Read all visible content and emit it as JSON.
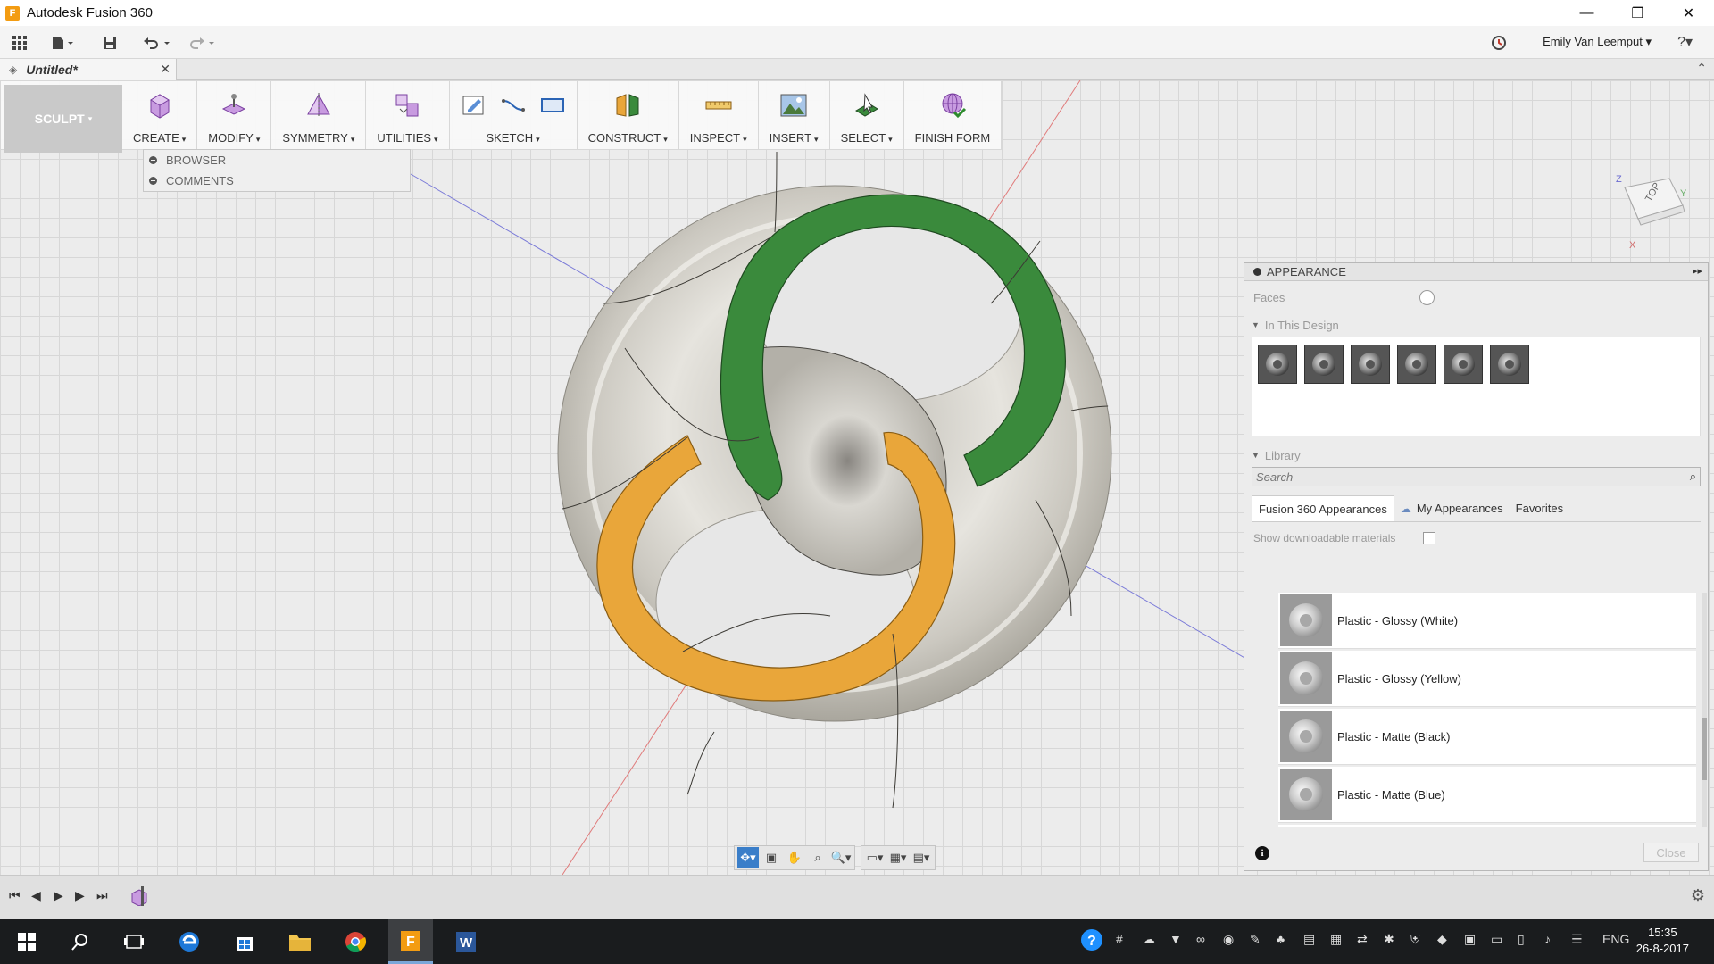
{
  "window": {
    "title": "Autodesk Fusion 360",
    "app_icon": "F",
    "minimize_glyph": "—",
    "restore_glyph": "❐",
    "close_glyph": "✕"
  },
  "quick_access": {
    "user_name": "Emily Van Leemput",
    "user_caret": "▾",
    "help_glyph": "?▾"
  },
  "document_tab": {
    "label": "Untitled*",
    "close_glyph": "✕",
    "collapse_glyph": "⌃"
  },
  "ribbon": {
    "workspace_label": "SCULPT",
    "workspace_caret": "▾",
    "groups": [
      {
        "label": "CREATE",
        "icon": "create-box-icon"
      },
      {
        "label": "MODIFY",
        "icon": "modify-icon"
      },
      {
        "label": "SYMMETRY",
        "icon": "symmetry-icon"
      },
      {
        "label": "UTILITIES",
        "icon": "utilities-icon"
      },
      {
        "label": "SKETCH",
        "icon": "sketch-icon"
      },
      {
        "label": "CONSTRUCT",
        "icon": "construct-plane-icon"
      },
      {
        "label": "INSPECT",
        "icon": "measure-icon"
      },
      {
        "label": "INSERT",
        "icon": "insert-image-icon"
      },
      {
        "label": "SELECT",
        "icon": "select-icon"
      },
      {
        "label": "FINISH FORM",
        "icon": "finish-form-icon"
      }
    ],
    "caret": "▾"
  },
  "browser": {
    "items": [
      "BROWSER",
      "COMMENTS"
    ]
  },
  "viewcube": {
    "face": "TOP",
    "axis_z": "Z",
    "axis_x": "X",
    "axis_y": "Y"
  },
  "appearance": {
    "title": "APPEARANCE",
    "pin_glyph": "▸▸",
    "faces_label": "Faces",
    "in_this_design_label": "In This Design",
    "design_swatch_count": 6,
    "library_label": "Library",
    "search_placeholder": "Search",
    "tabs": [
      "Fusion 360 Appearances",
      "My Appearances",
      "Favorites"
    ],
    "show_downloadable_label": "Show downloadable materials",
    "materials": [
      "Plastic - Glossy (White)",
      "Plastic - Glossy (Yellow)",
      "Plastic - Matte (Black)",
      "Plastic - Matte (Blue)"
    ],
    "info_glyph": "i",
    "close_label": "Close"
  },
  "navbar": {
    "buttons": [
      "✥▾",
      "▣",
      "✋",
      "⌕",
      "🔍▾",
      "▭▾",
      "▦▾",
      "▤▾"
    ]
  },
  "timeline": {
    "buttons": [
      "⏮",
      "◀",
      "▶",
      "▶",
      "⏭"
    ],
    "gear_glyph": "⚙"
  },
  "taskbar": {
    "language": "ENG",
    "time": "15:35",
    "date": "26-8-2017"
  },
  "colors": {
    "green_ring": "#3a8a3c",
    "yellow_ring": "#e9a63a",
    "model_body": "#d8d6cf",
    "accent_blue": "#3a7ec9"
  }
}
